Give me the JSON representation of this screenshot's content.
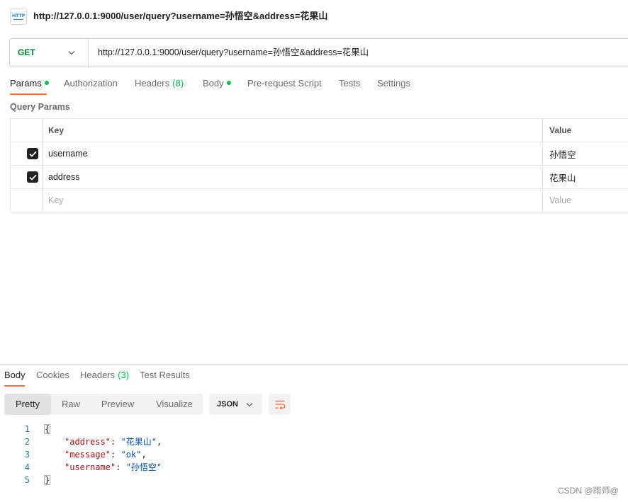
{
  "header": {
    "icon_label": "HTTP",
    "title": "http://127.0.0.1:9000/user/query?username=孙悟空&address=花果山"
  },
  "request": {
    "method": "GET",
    "url": "http://127.0.0.1:9000/user/query?username=孙悟空&address=花果山"
  },
  "request_tabs": [
    {
      "label": "Params",
      "indicator": true,
      "active": true
    },
    {
      "label": "Authorization"
    },
    {
      "label": "Headers",
      "count": "(8)"
    },
    {
      "label": "Body",
      "indicator": true
    },
    {
      "label": "Pre-request Script"
    },
    {
      "label": "Tests"
    },
    {
      "label": "Settings"
    }
  ],
  "query_params": {
    "title": "Query Params",
    "columns": {
      "key": "Key",
      "value": "Value"
    },
    "rows": [
      {
        "checked": true,
        "key": "username",
        "value": "孙悟空"
      },
      {
        "checked": true,
        "key": "address",
        "value": "花果山"
      }
    ],
    "placeholder": {
      "key": "Key",
      "value": "Value"
    }
  },
  "response": {
    "tabs": [
      {
        "label": "Body",
        "active": true
      },
      {
        "label": "Cookies"
      },
      {
        "label": "Headers",
        "count": "(3)"
      },
      {
        "label": "Test Results"
      }
    ],
    "view_modes": [
      {
        "label": "Pretty",
        "active": true
      },
      {
        "label": "Raw"
      },
      {
        "label": "Preview"
      },
      {
        "label": "Visualize"
      }
    ],
    "format": "JSON",
    "wrap_icon": "wrap-lines-icon",
    "code": {
      "line_numbers": [
        "1",
        "2",
        "3",
        "4",
        "5"
      ],
      "open_brace": "{",
      "entries": [
        {
          "key": "\"address\"",
          "colon": ": ",
          "value": "\"花果山\"",
          "comma": ","
        },
        {
          "key": "\"message\"",
          "colon": ": ",
          "value": "\"ok\"",
          "comma": ","
        },
        {
          "key": "\"username\"",
          "colon": ": ",
          "value": "\"孙悟空\"",
          "comma": ""
        }
      ],
      "close_brace": "}"
    }
  },
  "watermark": "CSDN @雨师@",
  "colors": {
    "accent_orange": "#ff6c37",
    "indicator_green": "#0cbb52",
    "method_green": "#007f31",
    "json_key": "#a31515",
    "json_string": "#0451a5",
    "line_number": "#237893"
  }
}
